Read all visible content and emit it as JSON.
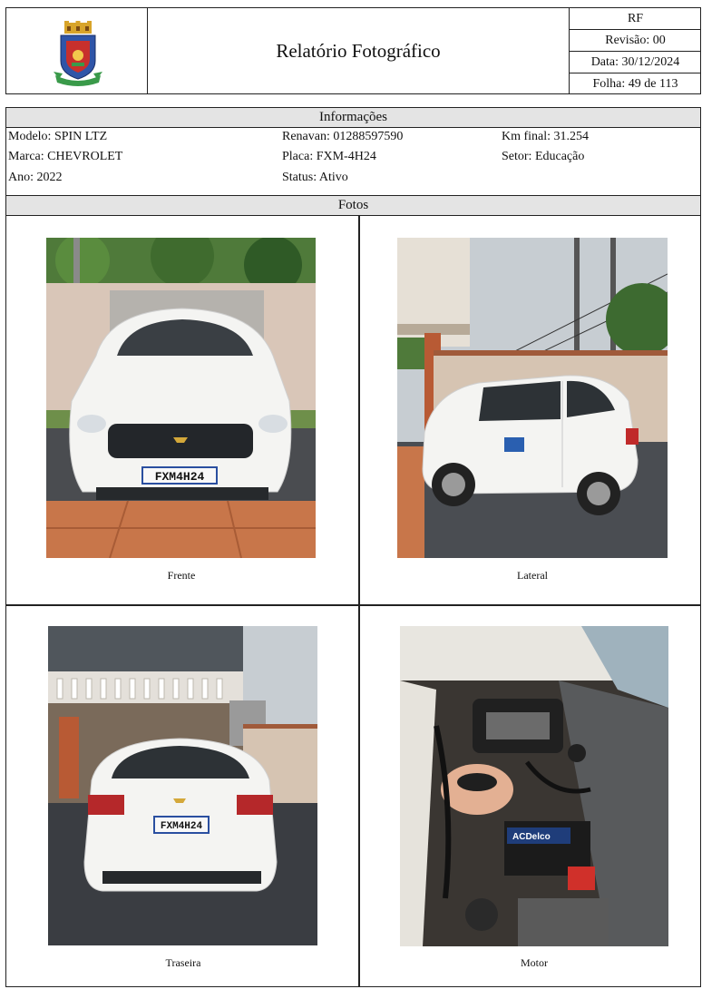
{
  "header": {
    "title": "Relatório Fotográfico",
    "code": "RF",
    "revision": "Revisão: 00",
    "date": "Data: 30/12/2024",
    "sheet": "Folha: 49 de 113",
    "logo": "municipal-coat-of-arms-icon"
  },
  "info": {
    "section_title": "Informações",
    "modelo": "Modelo: SPIN LTZ",
    "marca": "Marca: CHEVROLET",
    "ano": "Ano: 2022",
    "renavan": "Renavan: 01288597590",
    "placa": "Placa: FXM-4H24",
    "status": "Status: Ativo",
    "km_final": "Km final: 31.254",
    "setor": "Setor: Educação"
  },
  "fotos": {
    "section_title": "Fotos",
    "items": [
      {
        "caption": "Frente",
        "plate": "FXM4H24"
      },
      {
        "caption": "Lateral",
        "plate": ""
      },
      {
        "caption": "Traseira",
        "plate": "FXM4H24"
      },
      {
        "caption": "Motor",
        "plate": ""
      }
    ],
    "battery_brand": "ACDelco"
  },
  "colors": {
    "header_bar": "#e4e4e4",
    "car_body": "#f4f4f2",
    "floor_tile": "#c8764a",
    "asphalt": "#3a3d42"
  }
}
